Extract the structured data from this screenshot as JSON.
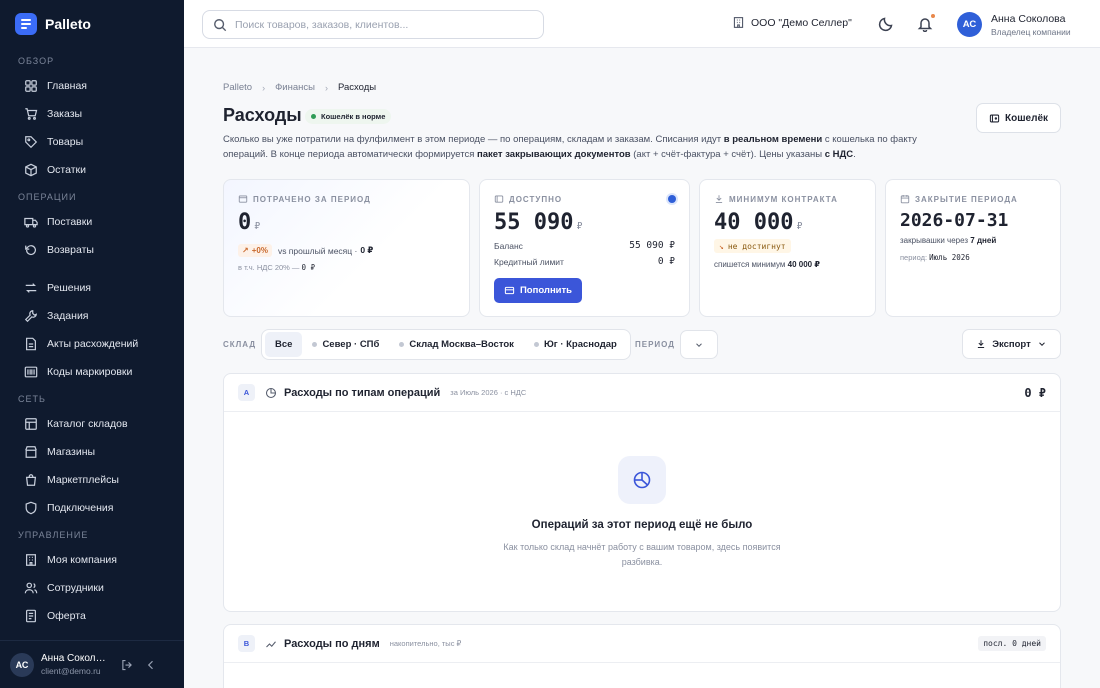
{
  "app": {
    "name": "Palleto"
  },
  "sidebar": {
    "sections": [
      {
        "label": "ОБЗОР",
        "items": [
          "Главная",
          "Заказы",
          "Товары",
          "Остатки"
        ]
      },
      {
        "label": "ОПЕРАЦИИ",
        "items": [
          "Поставки",
          "Возвраты"
        ]
      },
      {
        "label": "",
        "items": [
          "Решения",
          "Задания",
          "Акты расхождений",
          "Коды маркировки"
        ]
      },
      {
        "label": "СЕТЬ",
        "items": [
          "Каталог складов",
          "Магазины",
          "Маркетплейсы",
          "Подключения"
        ]
      },
      {
        "label": "УПРАВЛЕНИЕ",
        "items": [
          "Моя компания",
          "Сотрудники",
          "Оферта"
        ]
      }
    ],
    "user": {
      "initials": "АС",
      "name": "Анна Соколова",
      "email": "client@demo.ru"
    }
  },
  "topbar": {
    "search_placeholder": "Поиск товаров, заказов, клиентов...",
    "org": "ООО \"Демо Селлер\"",
    "user": {
      "initials": "АС",
      "name": "Анна Соколова",
      "role": "Владелец компании"
    }
  },
  "breadcrumbs": [
    "Palleto",
    "Финансы",
    "Расходы"
  ],
  "page": {
    "title": "Расходы",
    "badge": "Кошелёк в норме",
    "wallet_button": "Кошелёк",
    "desc_1": "Сколько вы уже потратили на фулфилмент в этом периоде — по операциям, складам и заказам. Списания идут ",
    "desc_b1": "в реальном времени",
    "desc_2": " с кошелька по факту операций. В конце периода автоматически формируется ",
    "desc_b2": "пакет закрывающих документов",
    "desc_3": " (акт + счёт-фактура + счёт). Цены указаны ",
    "desc_b3": "с НДС",
    "desc_4": "."
  },
  "cards": {
    "spent": {
      "label": "ПОТРАЧЕНО ЗА ПЕРИОД",
      "value": "0",
      "currency": "₽",
      "delta": "+0%",
      "compare_label": "vs прошлый месяц ·",
      "compare_value": "0 ₽",
      "vat_label": "в т.ч. НДС 20% —",
      "vat_value": "0 ₽"
    },
    "available": {
      "label": "ДОСТУПНО",
      "value": "55 090",
      "currency": "₽",
      "balance_label": "Баланс",
      "balance_value": "55 090 ₽",
      "credit_label": "Кредитный лимит",
      "credit_value": "0 ₽",
      "topup_button": "Пополнить"
    },
    "minimum": {
      "label": "МИНИМУМ КОНТРАКТА",
      "value": "40 000",
      "currency": "₽",
      "status": "не достигнут",
      "note_prefix": "спишется минимум",
      "note_value": "40 000 ₽"
    },
    "closing": {
      "label": "ЗАКРЫТИЕ ПЕРИОДА",
      "date": "2026-07-31",
      "in_prefix": "закрывашки через",
      "in_value": "7 дней",
      "period_prefix": "период:",
      "period_value": "Июль 2026"
    }
  },
  "filters": {
    "warehouse_label": "СКЛАД",
    "warehouses": [
      "Все",
      "Север · СПб",
      "Склад Москва–Восток",
      "Юг · Краснодар"
    ],
    "selected_warehouse": "Все",
    "period_label": "ПЕРИОД",
    "export_button": "Экспорт"
  },
  "panel_a": {
    "letter": "A",
    "title": "Расходы по типам операций",
    "subtitle": "за Июль 2026 · с НДС",
    "total": "0 ₽",
    "empty_title": "Операций за этот период ещё не было",
    "empty_text": "Как только склад начнёт работу с вашим товаром, здесь появится разбивка."
  },
  "panel_b": {
    "letter": "B",
    "title": "Расходы по дням",
    "subtitle": "накопительно, тыс ₽",
    "chip": "посл. 0 дней"
  }
}
